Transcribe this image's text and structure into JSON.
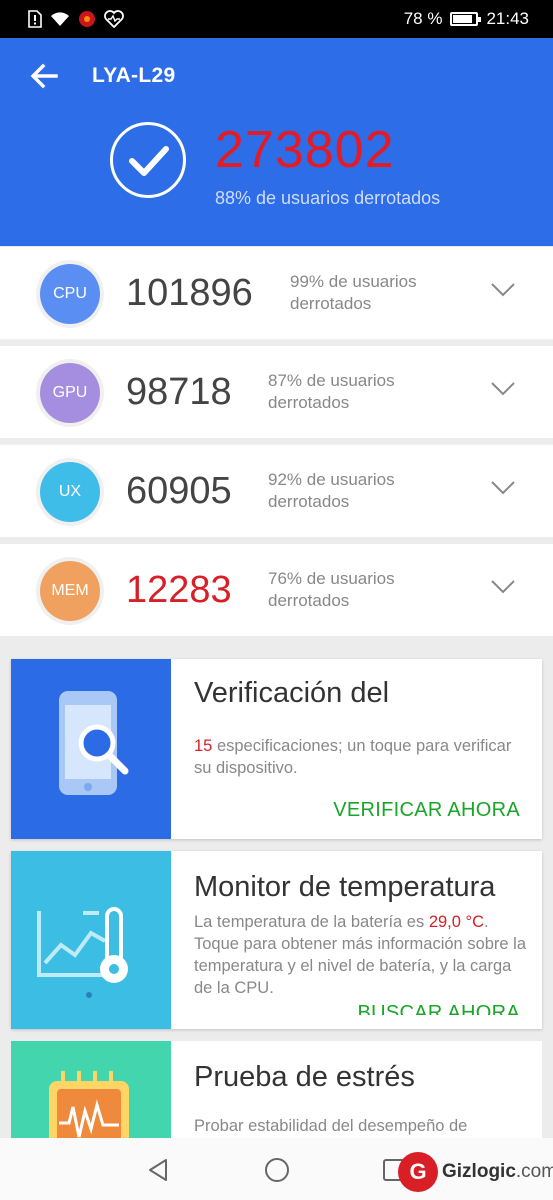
{
  "status_bar": {
    "battery_text": "78 %",
    "battery_level": 0.78,
    "time": "21:43"
  },
  "header": {
    "device_name": "LYA-L29",
    "total_score": "273802",
    "total_subtitle": "88% de usuarios derrotados",
    "color": "#2d6de8"
  },
  "scores": [
    {
      "badge": "CPU",
      "value": "101896",
      "desc": "99% de usuarios derrotados",
      "color": "#5b8ef2"
    },
    {
      "badge": "GPU",
      "value": "98718",
      "desc": "87% de usuarios derrotados",
      "color": "#a58de0"
    },
    {
      "badge": "UX",
      "value": "60905",
      "desc": "92% de usuarios derrotados",
      "color": "#3fbde9"
    },
    {
      "badge": "MEM",
      "value": "12283",
      "desc": "76% de usuarios derrotados",
      "color": "#f0a15f"
    }
  ],
  "cards": [
    {
      "title": "Verificación del",
      "text_number": "15",
      "text": " especificaciones; un toque para verificar su dispositivo.",
      "action": "VERIFICAR AHORA",
      "color": "#2b6ce6"
    },
    {
      "title": "Monitor de temperatura",
      "text_before": "La temperatura de la batería es ",
      "text_highlight": "29,0 °C",
      "text_after": ". Toque para obtener más información sobre la temperatura y el nivel de batería, y la carga de la CPU.",
      "action": "BUSCAR AHORA",
      "color": "#3cbde3"
    },
    {
      "title": "Prueba de estrés",
      "text": "Probar estabilidad del desempeño de",
      "color": "#43d6ae"
    }
  ],
  "watermark": {
    "brand": "Gizlogic",
    "suffix": ".com",
    "letter": "G"
  },
  "accent_green": "#19a627",
  "accent_red": "#d81f26"
}
